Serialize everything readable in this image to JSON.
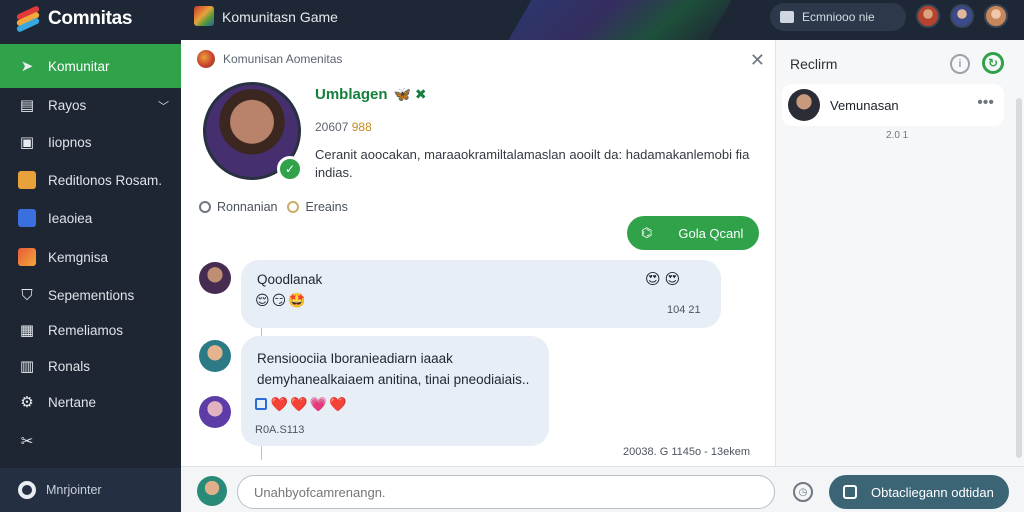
{
  "app": {
    "name": "Comnitas",
    "window_title": "Komunitasn Game"
  },
  "top_pill": {
    "label": "Ecmniooo nie"
  },
  "sidebar": {
    "items": [
      {
        "label": "Komunitar",
        "icon": "send-icon",
        "active": true
      },
      {
        "label": "Rayos",
        "icon": "book-icon",
        "chevron": true
      },
      {
        "label": "Iiopnos",
        "icon": "bag-icon"
      },
      {
        "label": "Reditlonos Rosam.",
        "icon": "controller-icon"
      },
      {
        "label": "Ieaoiea",
        "icon": "image-icon"
      },
      {
        "label": "Kemgnisa",
        "icon": "flag-icon"
      },
      {
        "label": "Sepementions",
        "icon": "shield-icon"
      },
      {
        "label": "Remeliamos",
        "icon": "grid-icon"
      },
      {
        "label": "Ronals",
        "icon": "list-icon"
      },
      {
        "label": "Nertane",
        "icon": "gear-icon"
      },
      {
        "label": "",
        "icon": "tool-icon"
      }
    ],
    "bottom_label": "Mnrjointer"
  },
  "main": {
    "breadcrumb": "Komunisan Aomenitas",
    "profile": {
      "name": "Umblagen",
      "name_emojis": "🦋 ✖",
      "meta_prefix": "20607",
      "meta_badge": "988",
      "bio": "Ceranit aoocakan, maraaokramiltalamaslan aooilt da: hadamakanlemobi fia indias."
    },
    "tabs": [
      {
        "label": "Ronnanian"
      },
      {
        "label": "Ereains"
      }
    ],
    "primary_button": "Gola Qcanl",
    "messages": [
      {
        "text": "Qoodlanak",
        "emojis_right": "😍😍",
        "emojis": "😌😏🤩",
        "time": "104 21"
      },
      {
        "text": "Rensioociia Iboranieadiarn iaaak demyhanealkaiaem anitina, tinai pneodiaiais..",
        "emojis": "❤️❤️💗❤️",
        "time": "R0A.S113"
      }
    ],
    "footer_time": "20038. G 1145o - 13ekem"
  },
  "right_panel": {
    "title": "Reclirm",
    "contact_name": "Vemunasan",
    "contact_sub": "2.0 1"
  },
  "composer": {
    "placeholder": "Unahbyofcamrenangn.",
    "send_label": "Obtacliegann odtidan"
  }
}
